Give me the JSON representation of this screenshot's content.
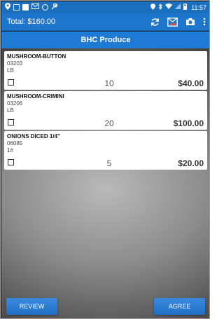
{
  "status_bar": {
    "time": "11:57"
  },
  "app_bar": {
    "total_label": "Total: $160.00"
  },
  "vendor": {
    "name": "BHC Produce"
  },
  "items": [
    {
      "name": "MUSHROOM-BUTTON",
      "code": "03203",
      "unit": "LB",
      "qty": "10",
      "price": "$40.00"
    },
    {
      "name": "MUSHROOM-CRIMINI",
      "code": "03206",
      "unit": "LB",
      "qty": "20",
      "price": "$100.00"
    },
    {
      "name": "ONIONS DICED 1/4\"",
      "code": "06085",
      "unit": "1#",
      "qty": "5",
      "price": "$20.00"
    }
  ],
  "buttons": {
    "review": "REVIEW",
    "agree": "AGREE"
  },
  "colors": {
    "primary": "#1e75cc",
    "status_bar": "#1c6fbf"
  }
}
